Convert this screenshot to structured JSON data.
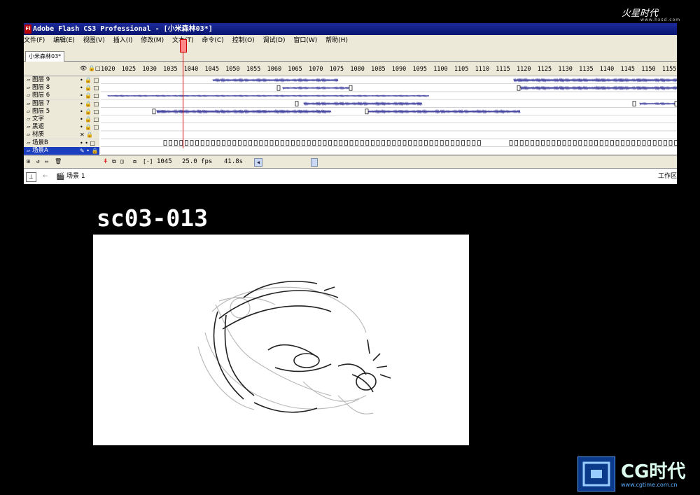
{
  "window": {
    "title": "Adobe Flash CS3 Professional - [小米森林03*]",
    "icon_label": "Fl",
    "menu": [
      "文件(F)",
      "编辑(E)",
      "视图(V)",
      "插入(I)",
      "修改(M)",
      "文本(T)",
      "命令(C)",
      "控制(O)",
      "调试(D)",
      "窗口(W)",
      "帮助(H)"
    ],
    "doc_tab": "小米森林03*"
  },
  "timeline": {
    "ruler_ticks": [
      "1020",
      "1025",
      "1030",
      "1035",
      "1040",
      "1045",
      "1050",
      "1055",
      "1060",
      "1065",
      "1070",
      "1075",
      "1080",
      "1085",
      "1090",
      "1095",
      "1100",
      "1105",
      "1110",
      "1115",
      "1120",
      "1125",
      "1130",
      "1135",
      "1140",
      "1145",
      "1150",
      "1155"
    ],
    "layers": [
      {
        "name": "图层 9",
        "state": "• 🔒 □"
      },
      {
        "name": "图层 8",
        "state": "• 🔒 □"
      },
      {
        "name": "图层 6",
        "state": "• 🔒 □"
      },
      {
        "name": "图层 7",
        "state": "• 🔒 □"
      },
      {
        "name": "图层 5",
        "state": "• 🔒 □"
      },
      {
        "name": "文字",
        "state": "• 🔒 □"
      },
      {
        "name": "黑遮",
        "state": "• 🔒 □"
      },
      {
        "name": "材质",
        "state": "✕ 🔒 □"
      },
      {
        "name": "场景B",
        "state": "• • □"
      },
      {
        "name": "场景A",
        "state": "✎ • 🔒 □"
      }
    ],
    "current_frame": "1045",
    "fps": "25.0 fps",
    "time": "41.8s"
  },
  "scene_bar": {
    "scene": "场景 1",
    "workspace": "工作区"
  },
  "scene_label": "sc03-013",
  "logos": {
    "top": "火星时代",
    "top_url": "www.hxsd.com",
    "bottom": "CG时代",
    "bottom_url": "www.cgtime.com.cn"
  },
  "colors": {
    "titlebar": "#0a1570",
    "selected_layer": "#1c3fbf",
    "playhead": "#dd0000",
    "waveform": "#1a1a8a"
  }
}
